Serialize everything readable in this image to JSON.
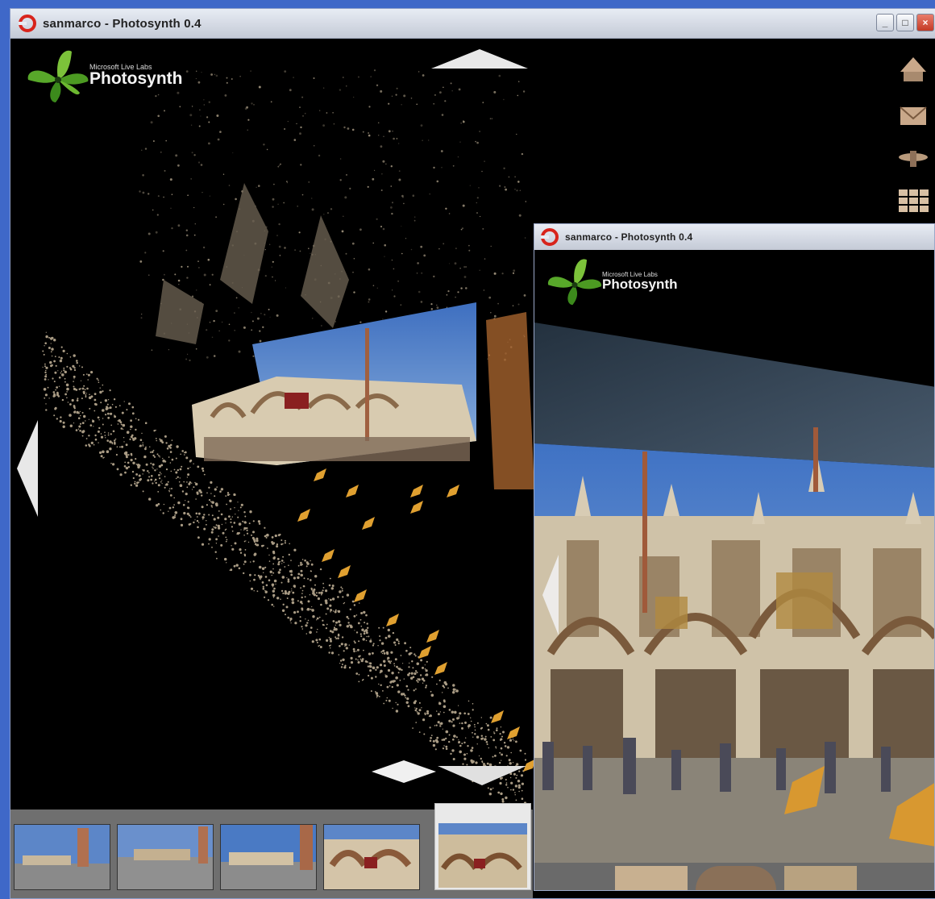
{
  "window_main": {
    "title": "sanmarco - Photosynth 0.4",
    "logo": {
      "subtitle": "Microsoft Live Labs",
      "name": "Photosynth"
    },
    "side_icons": [
      "halo-view-icon",
      "envelope-icon",
      "overhead-view-icon",
      "grid-view-icon"
    ],
    "thumbnails": [
      "thumb-1",
      "thumb-2",
      "thumb-3",
      "thumb-4",
      "thumb-5"
    ],
    "selected_thumbnail": 5
  },
  "window_second": {
    "title": "sanmarco - Photosynth 0.4",
    "logo": {
      "subtitle": "Microsoft Live Labs",
      "name": "Photosynth"
    }
  },
  "colors": {
    "desktop": "#3f68c8",
    "titlebar": "#d6dbe6",
    "point_cloud": "#c8a87a",
    "camera_markers": "#e0a030",
    "sky": "#4f7fc5"
  }
}
